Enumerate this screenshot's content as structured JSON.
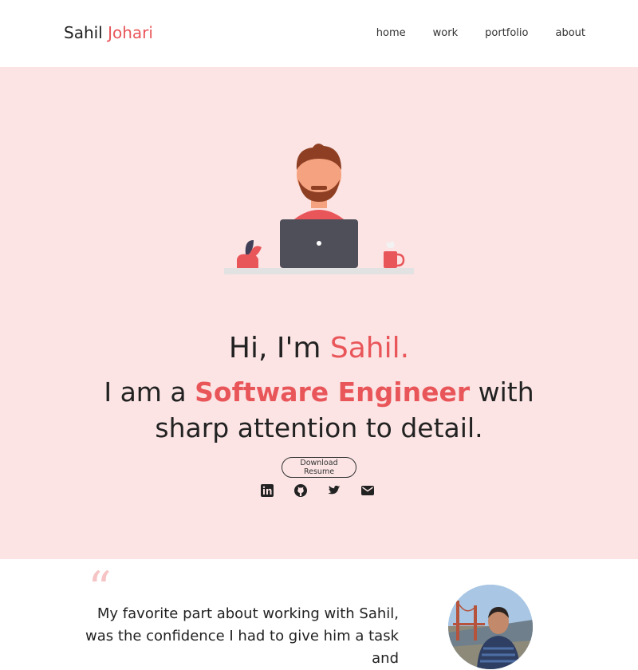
{
  "header": {
    "first_name": "Sahil",
    "last_name": "Johari",
    "nav": [
      {
        "label": "home"
      },
      {
        "label": "work"
      },
      {
        "label": "portfolio"
      },
      {
        "label": "about"
      }
    ]
  },
  "hero": {
    "greeting_prefix": "Hi, I'm ",
    "greeting_name": "Sahil.",
    "tagline_prefix": "I am a ",
    "tagline_role": "Software Engineer",
    "tagline_suffix": " with sharp attention to detail.",
    "resume_button": "Download Resume",
    "social_icons": [
      "linkedin-icon",
      "github-icon",
      "twitter-icon",
      "email-icon"
    ]
  },
  "testimonial": {
    "quote_mark": "“",
    "quote_text": "My favorite part about working with Sahil, was the confidence I had to give him a task and"
  },
  "colors": {
    "accent": "#e9565a",
    "hero_background": "#fce4e4",
    "quote_mark": "#f6c4c5"
  }
}
